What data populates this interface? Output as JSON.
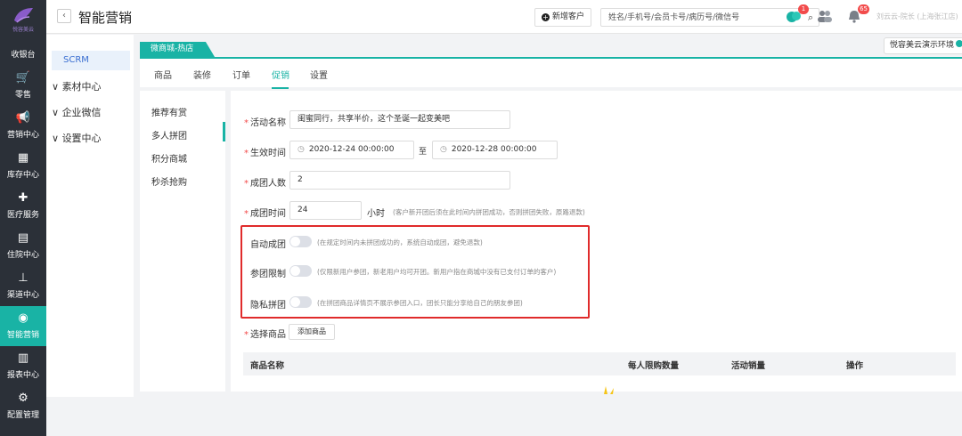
{
  "brand": {
    "logo_text": "悦容美云",
    "accent": "#19b3a5",
    "rail_bg": "#2b3038"
  },
  "rail": [
    {
      "label": "收银台",
      "icon": "cashier-icon"
    },
    {
      "label": "零售",
      "icon": "cart-icon"
    },
    {
      "label": "营销中心",
      "icon": "megaphone-icon"
    },
    {
      "label": "库存中心",
      "icon": "grid-icon"
    },
    {
      "label": "医疗服务",
      "icon": "medkit-icon"
    },
    {
      "label": "住院中心",
      "icon": "clipboard-icon"
    },
    {
      "label": "渠道中心",
      "icon": "sitemap-icon"
    },
    {
      "label": "智能营销",
      "icon": "smart-marketing-icon",
      "active": true
    },
    {
      "label": "报表中心",
      "icon": "bar-chart-icon"
    },
    {
      "label": "配置管理",
      "icon": "gear-icon"
    }
  ],
  "header": {
    "back_icon": "chevron-left-icon",
    "title": "智能营销",
    "new_customer": "新增客户",
    "search_placeholder": "姓名/手机号/会员卡号/病历号/微信号",
    "chat_badge": "1",
    "bell_badge": "65",
    "user": "刘云云-院长 (上海张江店)"
  },
  "subside": {
    "active": "SCRM",
    "items": [
      "素材中心",
      "企业微信",
      "设置中心"
    ]
  },
  "env_tag": "悦容美云演示环境",
  "store_tab": "微商城-热店",
  "tabs": [
    "商品",
    "装修",
    "订单",
    "促销",
    "设置"
  ],
  "types": [
    "推荐有赏",
    "多人拼团",
    "积分商城",
    "秒杀抢购"
  ],
  "form": {
    "activity_name_label": "活动名称",
    "activity_name_value": "闺蜜同行，共享半价，这个圣诞一起变美吧",
    "time_label": "生效时间",
    "start_time": "2020-12-24 00:00:00",
    "to": "至",
    "end_time": "2020-12-28 00:00:00",
    "group_size_label": "成团人数",
    "group_size_value": "2",
    "group_time_label": "成团时间",
    "group_time_value": "24",
    "group_time_unit": "小时",
    "group_time_note": "(客户新开团后须在此时间内拼团成功，否则拼团失败，原路退款)",
    "auto_label": "自动成团",
    "auto_note": "(在规定时间内未拼团成功的，系统自动成团，避免退款)",
    "limit_label": "参团限制",
    "limit_note": "(仅限新用户参团，新老用户均可开团。新用户指在商城中没有已支付订单的客户)",
    "private_label": "隐私拼团",
    "private_note": "(在拼团商品详情页不展示参团入口，团长只能分享给自己的朋友参团)",
    "product_label": "选择商品",
    "add_product": "添加商品"
  },
  "table": {
    "headers": [
      "商品名称",
      "每人限购数量",
      "活动销量",
      "操作"
    ]
  }
}
